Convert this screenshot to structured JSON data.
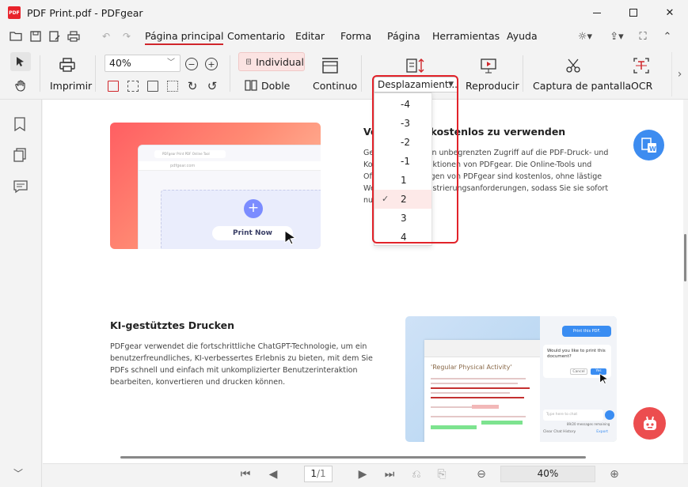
{
  "window": {
    "title": "PDF Print.pdf - PDFgear",
    "logo_text": "PDF"
  },
  "menu": {
    "items": [
      {
        "label": "Página principal",
        "active": true
      },
      {
        "label": "Comentario"
      },
      {
        "label": "Editar"
      },
      {
        "label": "Forma"
      },
      {
        "label": "Página"
      },
      {
        "label": "Herramientas"
      },
      {
        "label": "Ayuda"
      }
    ]
  },
  "ribbon": {
    "print_label": "Imprimir",
    "zoom_value": "40%",
    "individual_label": "Individual",
    "double_label": "Doble",
    "continuous_label": "Continuo",
    "scroll_select_label": "Desplazamient...",
    "play_label": "Reproducir",
    "screenshot_label": "Captura de pantalla",
    "ocr_label": "OCR"
  },
  "dropdown": {
    "options": [
      "-4",
      "-3",
      "-2",
      "-1",
      "1",
      "2",
      "3",
      "4"
    ],
    "selected": "2"
  },
  "document": {
    "hero": {
      "browser_tab": "PDFgear Print PDF Online Tool",
      "browser_url": "pdfgear.com",
      "print_button": "Print Now"
    },
    "free_heading": "Vorteile, es kostenlos zu verwenden",
    "free_text": "Genießen Sie einen unbegrenzten Zugriff auf die PDF-Druck- und Konvertierungsfunktionen von PDFgear. Die Online-Tools und Offline-Anwendungen von PDFgear sind kostenlos, ohne lästige Werbung und Registrierungsanforderungen, sodass Sie sie sofort nutzen können.",
    "ai_heading": "KI-gestütztes Drucken",
    "ai_text": "PDFgear verwendet die fortschrittliche ChatGPT-Technologie, um ein benutzerfreundliches, KI-verbessertes Erlebnis zu bieten, mit dem Sie PDFs schnell und einfach mit unkomplizierter Benutzerinteraktion bearbeiten, konvertieren und drucken können.",
    "ai_card": {
      "doc_title": "'Regular Physical Activity'",
      "chat_request": "Print this PDF.",
      "chat_question": "Would you like to print this document?",
      "cancel": "Cancel",
      "yes": "Yes",
      "input_placeholder": "Type here to chat",
      "messages_remaining": "89/20 messages remaining",
      "clear_history": "Clear Chat History",
      "export": "Export"
    }
  },
  "status": {
    "page": "1",
    "total": "/1",
    "zoom": "40%"
  },
  "colors": {
    "accent": "#d0262b",
    "highlight": "#e2232a",
    "word_badge": "#3d8cf0",
    "bot_badge": "#ec4d4f"
  }
}
